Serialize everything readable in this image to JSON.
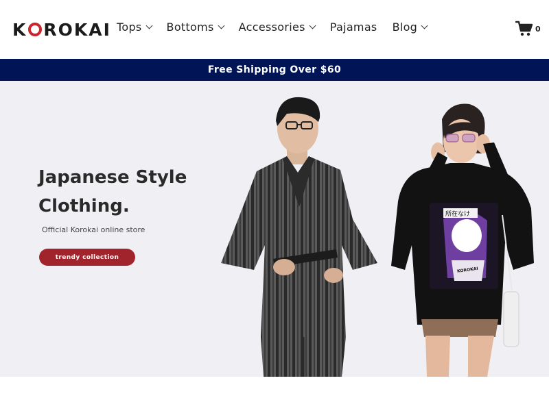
{
  "header": {
    "logo_prefix": "K",
    "logo_suffix": "ROKAI",
    "nav": [
      {
        "label": "Tops",
        "has_dropdown": true
      },
      {
        "label": "Bottoms",
        "has_dropdown": true
      },
      {
        "label": "Accessories",
        "has_dropdown": true
      },
      {
        "label": "Pajamas",
        "has_dropdown": false
      },
      {
        "label": "Blog",
        "has_dropdown": true
      }
    ],
    "cart": {
      "icon": "cart-icon",
      "count": "0"
    }
  },
  "promo": {
    "text": "Free Shipping Over $60"
  },
  "hero": {
    "title_line1": "Japanese Style",
    "title_line2": "Clothing.",
    "subtitle": "Official Korokai online store",
    "cta_label": "trendy collection",
    "sweatshirt_text_1": "所在なけ",
    "sweatshirt_text_2": "KOROKAI"
  },
  "colors": {
    "brand_red": "#c9262e",
    "promo_bg": "#001456",
    "cta_bg": "#a1232b",
    "hero_bg": "#f0f0f4"
  }
}
